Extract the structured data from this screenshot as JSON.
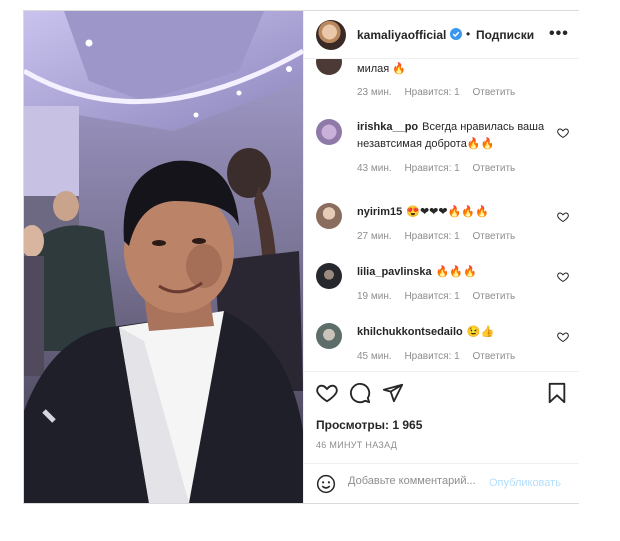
{
  "header": {
    "username": "kamaliyaofficial",
    "separator": "•",
    "follow_label": "Подписки",
    "more_label": "•••"
  },
  "comments": [
    {
      "user": "",
      "text": "милая 🔥",
      "time": "23 мин.",
      "likes": "Нравится: 1",
      "reply": "Ответить"
    },
    {
      "user": "irishka__po",
      "text": "Всегда нравилась ваша незавтсимая доброта🔥🔥",
      "time": "43 мин.",
      "likes": "Нравится: 1",
      "reply": "Ответить"
    },
    {
      "user": "nyirim15",
      "text": "😍❤❤❤🔥🔥🔥",
      "time": "27 мин.",
      "likes": "Нравится: 1",
      "reply": "Ответить"
    },
    {
      "user": "lilia_pavlinska",
      "text": "🔥🔥🔥",
      "time": "19 мин.",
      "likes": "Нравится: 1",
      "reply": "Ответить"
    },
    {
      "user": "khilchukkontsedailo",
      "text": "😉👍",
      "time": "45 мин.",
      "likes": "Нравится: 1",
      "reply": "Ответить"
    }
  ],
  "stats": {
    "views": "Просмотры: 1 965",
    "posted": "46 МИНУТ НАЗАД"
  },
  "composer": {
    "placeholder": "Добавьте комментарий...",
    "publish_label": "Опубликовать"
  },
  "colors": {
    "accent_disabled": "#b2dffc",
    "verified": "#3897f0",
    "muted": "#8e8e8e"
  }
}
